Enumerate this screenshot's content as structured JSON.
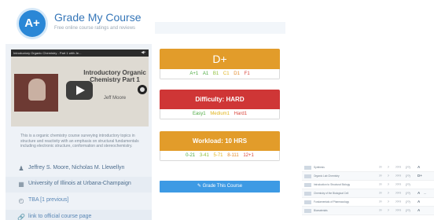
{
  "brand": {
    "logo": "A+",
    "title": "Grade My Course",
    "subtitle": "Free online course ratings and reviews"
  },
  "video": {
    "bar_title": "Introductory Organic Chemistry - Part 1 with Je...",
    "share_icon": "share-icon",
    "slide_title": "Introductory Organic Chemistry Part 1",
    "slide_author": "Jeff Moore"
  },
  "description": "This is a organic chemistry course surveying introductory topics in structure and reactivity with an emphasis on structural fundamentals including electronic structure, conformation and stereochemistry.",
  "info": [
    {
      "icon": "person-icon",
      "text": "Jeffrey S. Moore, Nicholas M. Llewellyn"
    },
    {
      "icon": "institution-icon",
      "text": "University of Illinois at Urbana-Champaign"
    },
    {
      "icon": "clock-icon",
      "text": "TBA [1 previous]"
    },
    {
      "icon": "link-icon",
      "text": "link to official course page"
    }
  ],
  "colors": {
    "accent": "#3d9ae4",
    "grade_card": "#e29c2a",
    "difficulty_card": "#cf3636",
    "sidebar_bg": "#eef2f7"
  },
  "grade": {
    "label": "D+",
    "breakdown": [
      {
        "label": "A+",
        "count": "1"
      },
      {
        "label": "A",
        "count": "1"
      },
      {
        "label": "B",
        "count": "1"
      },
      {
        "label": "C",
        "count": "1"
      },
      {
        "label": "D",
        "count": "1"
      },
      {
        "label": "F",
        "count": "1"
      }
    ]
  },
  "difficulty": {
    "label": "Difficulty: HARD",
    "breakdown": [
      {
        "label": "Easy",
        "count": "1"
      },
      {
        "label": "Medium",
        "count": "1"
      },
      {
        "label": "Hard",
        "count": "1"
      }
    ]
  },
  "workload": {
    "label": "Workload: 10 HRS",
    "breakdown": [
      {
        "label": "0-2",
        "count": "1"
      },
      {
        "label": "3-4",
        "count": "1"
      },
      {
        "label": "5-7",
        "count": "1"
      },
      {
        "label": "8-11",
        "count": "1"
      },
      {
        "label": "12+",
        "count": "1"
      }
    ]
  },
  "grade_button": {
    "icon": "pencil-icon",
    "label": "Grade This Course"
  },
  "course_table": [
    {
      "name": "Synthesis",
      "n1": "??",
      "n2": "?",
      "n3": "????",
      "n4": "(??)",
      "grade": "A",
      "diff": ""
    },
    {
      "name": "Organic Lab Chemistry",
      "n1": "??",
      "n2": "?",
      "n3": "????",
      "n4": "(??)",
      "grade": "D+",
      "diff": ""
    },
    {
      "name": "Introduction to Structural Biology",
      "n1": "??",
      "n2": "?",
      "n3": "????",
      "n4": "(??)",
      "grade": "",
      "diff": ""
    },
    {
      "name": "Chemistry of the Biological Cell",
      "n1": "??",
      "n2": "?",
      "n3": "????",
      "n4": "(??)",
      "grade": "A",
      "diff": "---"
    },
    {
      "name": "Fundamentals of Pharmacology",
      "n1": "??",
      "n2": "?",
      "n3": "????",
      "n4": "(??)",
      "grade": "A",
      "diff": ""
    },
    {
      "name": "Biomaterials",
      "n1": "??",
      "n2": "?",
      "n3": "????",
      "n4": "(??)",
      "grade": "A",
      "diff": ""
    }
  ]
}
